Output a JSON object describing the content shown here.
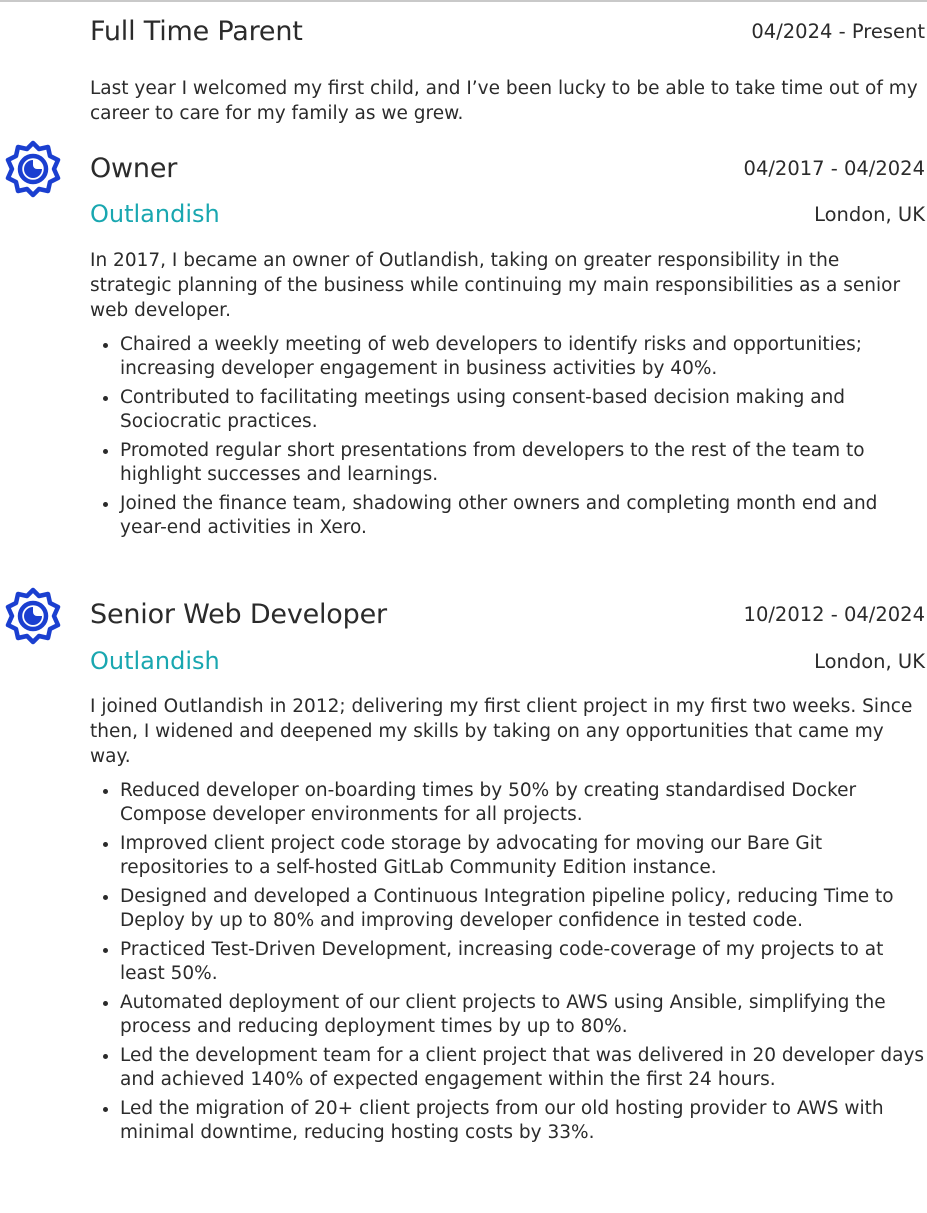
{
  "entries": [
    {
      "title": "Full Time Parent",
      "dates": "04/2024 - Present",
      "summary": "Last year I welcomed my first child, and I’ve been lucky to be able to take time out of my career to care for my family as we grew."
    },
    {
      "title": "Owner",
      "dates": "04/2017 - 04/2024",
      "company": "Outlandish",
      "location": "London, UK",
      "logo_icon": "outlandish-logo-icon",
      "summary": "In 2017, I became an owner of Outlandish, taking on greater responsibility in the strategic planning of the business while continuing my main responsibilities as a senior web developer.",
      "bullets": [
        "Chaired a weekly meeting of web developers to identify risks and opportunities; increasing developer engagement in business activities by 40%.",
        "Contributed to facilitating meetings using consent-based decision making and Sociocratic practices.",
        "Promoted regular short presentations from developers to the rest of the team to highlight successes and learnings.",
        "Joined the finance team, shadowing other owners and completing month end and year-end activities in Xero."
      ]
    },
    {
      "title": "Senior Web Developer",
      "dates": "10/2012 - 04/2024",
      "company": "Outlandish",
      "location": "London, UK",
      "logo_icon": "outlandish-logo-icon",
      "summary": "I joined Outlandish in 2012; delivering my first client project in my first two weeks. Since then, I widened and deepened my skills by taking on any opportunities that came my way.",
      "bullets": [
        "Reduced developer on-boarding times by 50% by creating standardised Docker Compose developer environments for all projects.",
        "Improved client project code storage by advocating for moving our Bare Git repositories to a self-hosted GitLab Community Edition instance.",
        "Designed and developed a Continuous Integration pipeline policy, reducing Time to Deploy by up to 80% and improving developer confidence in tested code.",
        "Practiced Test-Driven Development, increasing code-coverage of my projects to at least 50%.",
        "Automated deployment of our client projects to AWS using Ansible, simplifying the process and reducing deployment times by up to 80%.",
        "Led the development team for a client project that was delivered in 20 developer days and achieved 140% of expected engagement within the first 24 hours.",
        "Led the migration of 20+ client projects from our old hosting provider to AWS with minimal downtime, reducing hosting costs by 33%."
      ]
    }
  ],
  "colors": {
    "accent": "#19a7b0",
    "logo": "#1b3fd0",
    "text": "#2b2b2b"
  }
}
